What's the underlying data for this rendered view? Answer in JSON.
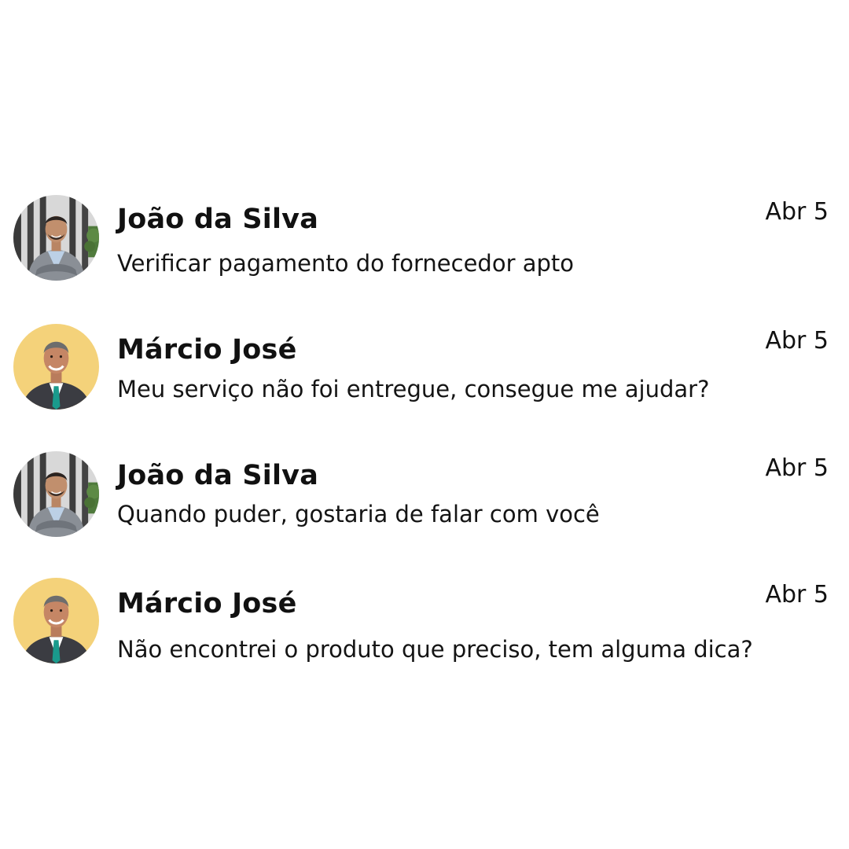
{
  "messages": [
    {
      "sender": "João da Silva",
      "preview": "Verificar pagamento do fornecedor apto",
      "date": "Abr 5",
      "avatar": {
        "background": "#cfcfcf",
        "style": "striped-office"
      }
    },
    {
      "sender": "Márcio José",
      "preview": "Meu serviço não foi entregue, consegue me ajudar?",
      "date": "Abr 5",
      "avatar": {
        "background": "#f4d27a",
        "style": "yellow-studio"
      }
    },
    {
      "sender": "João da Silva",
      "preview": "Quando puder, gostaria de falar com você",
      "date": "Abr 5",
      "avatar": {
        "background": "#cfcfcf",
        "style": "striped-office"
      }
    },
    {
      "sender": "Márcio José",
      "preview": "Não encontrei o produto  que preciso, tem alguma dica?",
      "date": "Abr 5",
      "avatar": {
        "background": "#f4d27a",
        "style": "yellow-studio"
      }
    }
  ]
}
